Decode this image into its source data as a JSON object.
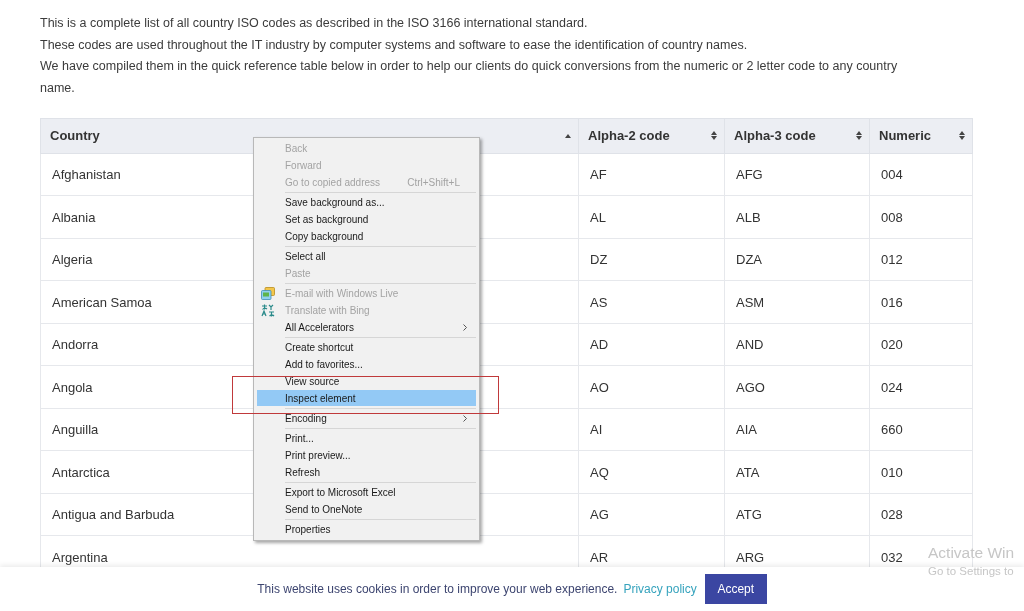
{
  "intro": [
    "This is a complete list of all country ISO codes as described in the ISO 3166 international standard.",
    "These codes are used throughout the IT industry by computer systems and software to ease the identification of country names.",
    "We have compiled them in the quick reference table below in order to help our clients do quick conversions from the numeric or 2 letter code to any country name."
  ],
  "table": {
    "columns": [
      {
        "label": "Country",
        "sorted": true
      },
      {
        "label": "Alpha-2 code",
        "sorted": false
      },
      {
        "label": "Alpha-3 code",
        "sorted": false
      },
      {
        "label": "Numeric",
        "sorted": false
      }
    ],
    "rows": [
      [
        "Afghanistan",
        "AF",
        "AFG",
        "004"
      ],
      [
        "Albania",
        "AL",
        "ALB",
        "008"
      ],
      [
        "Algeria",
        "DZ",
        "DZA",
        "012"
      ],
      [
        "American Samoa",
        "AS",
        "ASM",
        "016"
      ],
      [
        "Andorra",
        "AD",
        "AND",
        "020"
      ],
      [
        "Angola",
        "AO",
        "AGO",
        "024"
      ],
      [
        "Anguilla",
        "AI",
        "AIA",
        "660"
      ],
      [
        "Antarctica",
        "AQ",
        "ATA",
        "010"
      ],
      [
        "Antigua and Barbuda",
        "AG",
        "ATG",
        "028"
      ],
      [
        "Argentina",
        "AR",
        "ARG",
        "032"
      ]
    ]
  },
  "context_menu": {
    "groups": [
      {
        "items": [
          {
            "label": "Back",
            "disabled": true,
            "selected": false,
            "has_icon": false,
            "submenu": false
          },
          {
            "label": "Forward",
            "disabled": true,
            "selected": false,
            "has_icon": false,
            "submenu": false
          },
          {
            "label": "Go to copied address",
            "shortcut": "Ctrl+Shift+L",
            "disabled": true,
            "selected": false,
            "has_icon": false,
            "submenu": false
          }
        ]
      },
      {
        "items": [
          {
            "label": "Save background as...",
            "disabled": false,
            "selected": false,
            "has_icon": false,
            "submenu": false
          },
          {
            "label": "Set as background",
            "disabled": false,
            "selected": false,
            "has_icon": false,
            "submenu": false
          },
          {
            "label": "Copy background",
            "disabled": false,
            "selected": false,
            "has_icon": false,
            "submenu": false
          }
        ]
      },
      {
        "items": [
          {
            "label": "Select all",
            "disabled": false,
            "selected": false,
            "has_icon": false,
            "submenu": false
          },
          {
            "label": "Paste",
            "disabled": true,
            "selected": false,
            "has_icon": false,
            "submenu": false
          }
        ]
      },
      {
        "items": [
          {
            "label": "E-mail with Windows Live",
            "disabled": true,
            "selected": false,
            "has_icon": true,
            "submenu": false
          },
          {
            "label": "Translate with Bing",
            "disabled": true,
            "selected": false,
            "has_icon": true,
            "submenu": false
          },
          {
            "label": "All Accelerators",
            "disabled": false,
            "selected": false,
            "has_icon": false,
            "submenu": true
          }
        ]
      },
      {
        "items": [
          {
            "label": "Create shortcut",
            "disabled": false,
            "selected": false,
            "has_icon": false,
            "submenu": false
          },
          {
            "label": "Add to favorites...",
            "disabled": false,
            "selected": false,
            "has_icon": false,
            "submenu": false
          },
          {
            "label": "View source",
            "disabled": false,
            "selected": false,
            "has_icon": false,
            "submenu": false
          },
          {
            "label": "Inspect element",
            "disabled": false,
            "selected": true,
            "has_icon": false,
            "submenu": false
          }
        ]
      },
      {
        "items": [
          {
            "label": "Encoding",
            "disabled": false,
            "selected": false,
            "has_icon": false,
            "submenu": true
          }
        ]
      },
      {
        "items": [
          {
            "label": "Print...",
            "disabled": false,
            "selected": false,
            "has_icon": false,
            "submenu": false
          },
          {
            "label": "Print preview...",
            "disabled": false,
            "selected": false,
            "has_icon": false,
            "submenu": false
          },
          {
            "label": "Refresh",
            "disabled": false,
            "selected": false,
            "has_icon": false,
            "submenu": false
          }
        ]
      },
      {
        "items": [
          {
            "label": "Export to Microsoft Excel",
            "disabled": false,
            "selected": false,
            "has_icon": false,
            "submenu": false
          },
          {
            "label": "Send to OneNote",
            "disabled": false,
            "selected": false,
            "has_icon": false,
            "submenu": false
          }
        ]
      },
      {
        "items": [
          {
            "label": "Properties",
            "disabled": false,
            "selected": false,
            "has_icon": false,
            "submenu": false
          }
        ]
      }
    ]
  },
  "annotation_box": true,
  "cookie_banner": {
    "message": "This website uses cookies in order to improve your web experience.",
    "link": "Privacy policy",
    "button": "Accept"
  },
  "os_notice": {
    "title": "Activate Win",
    "subtitle": "Go to Settings to"
  }
}
